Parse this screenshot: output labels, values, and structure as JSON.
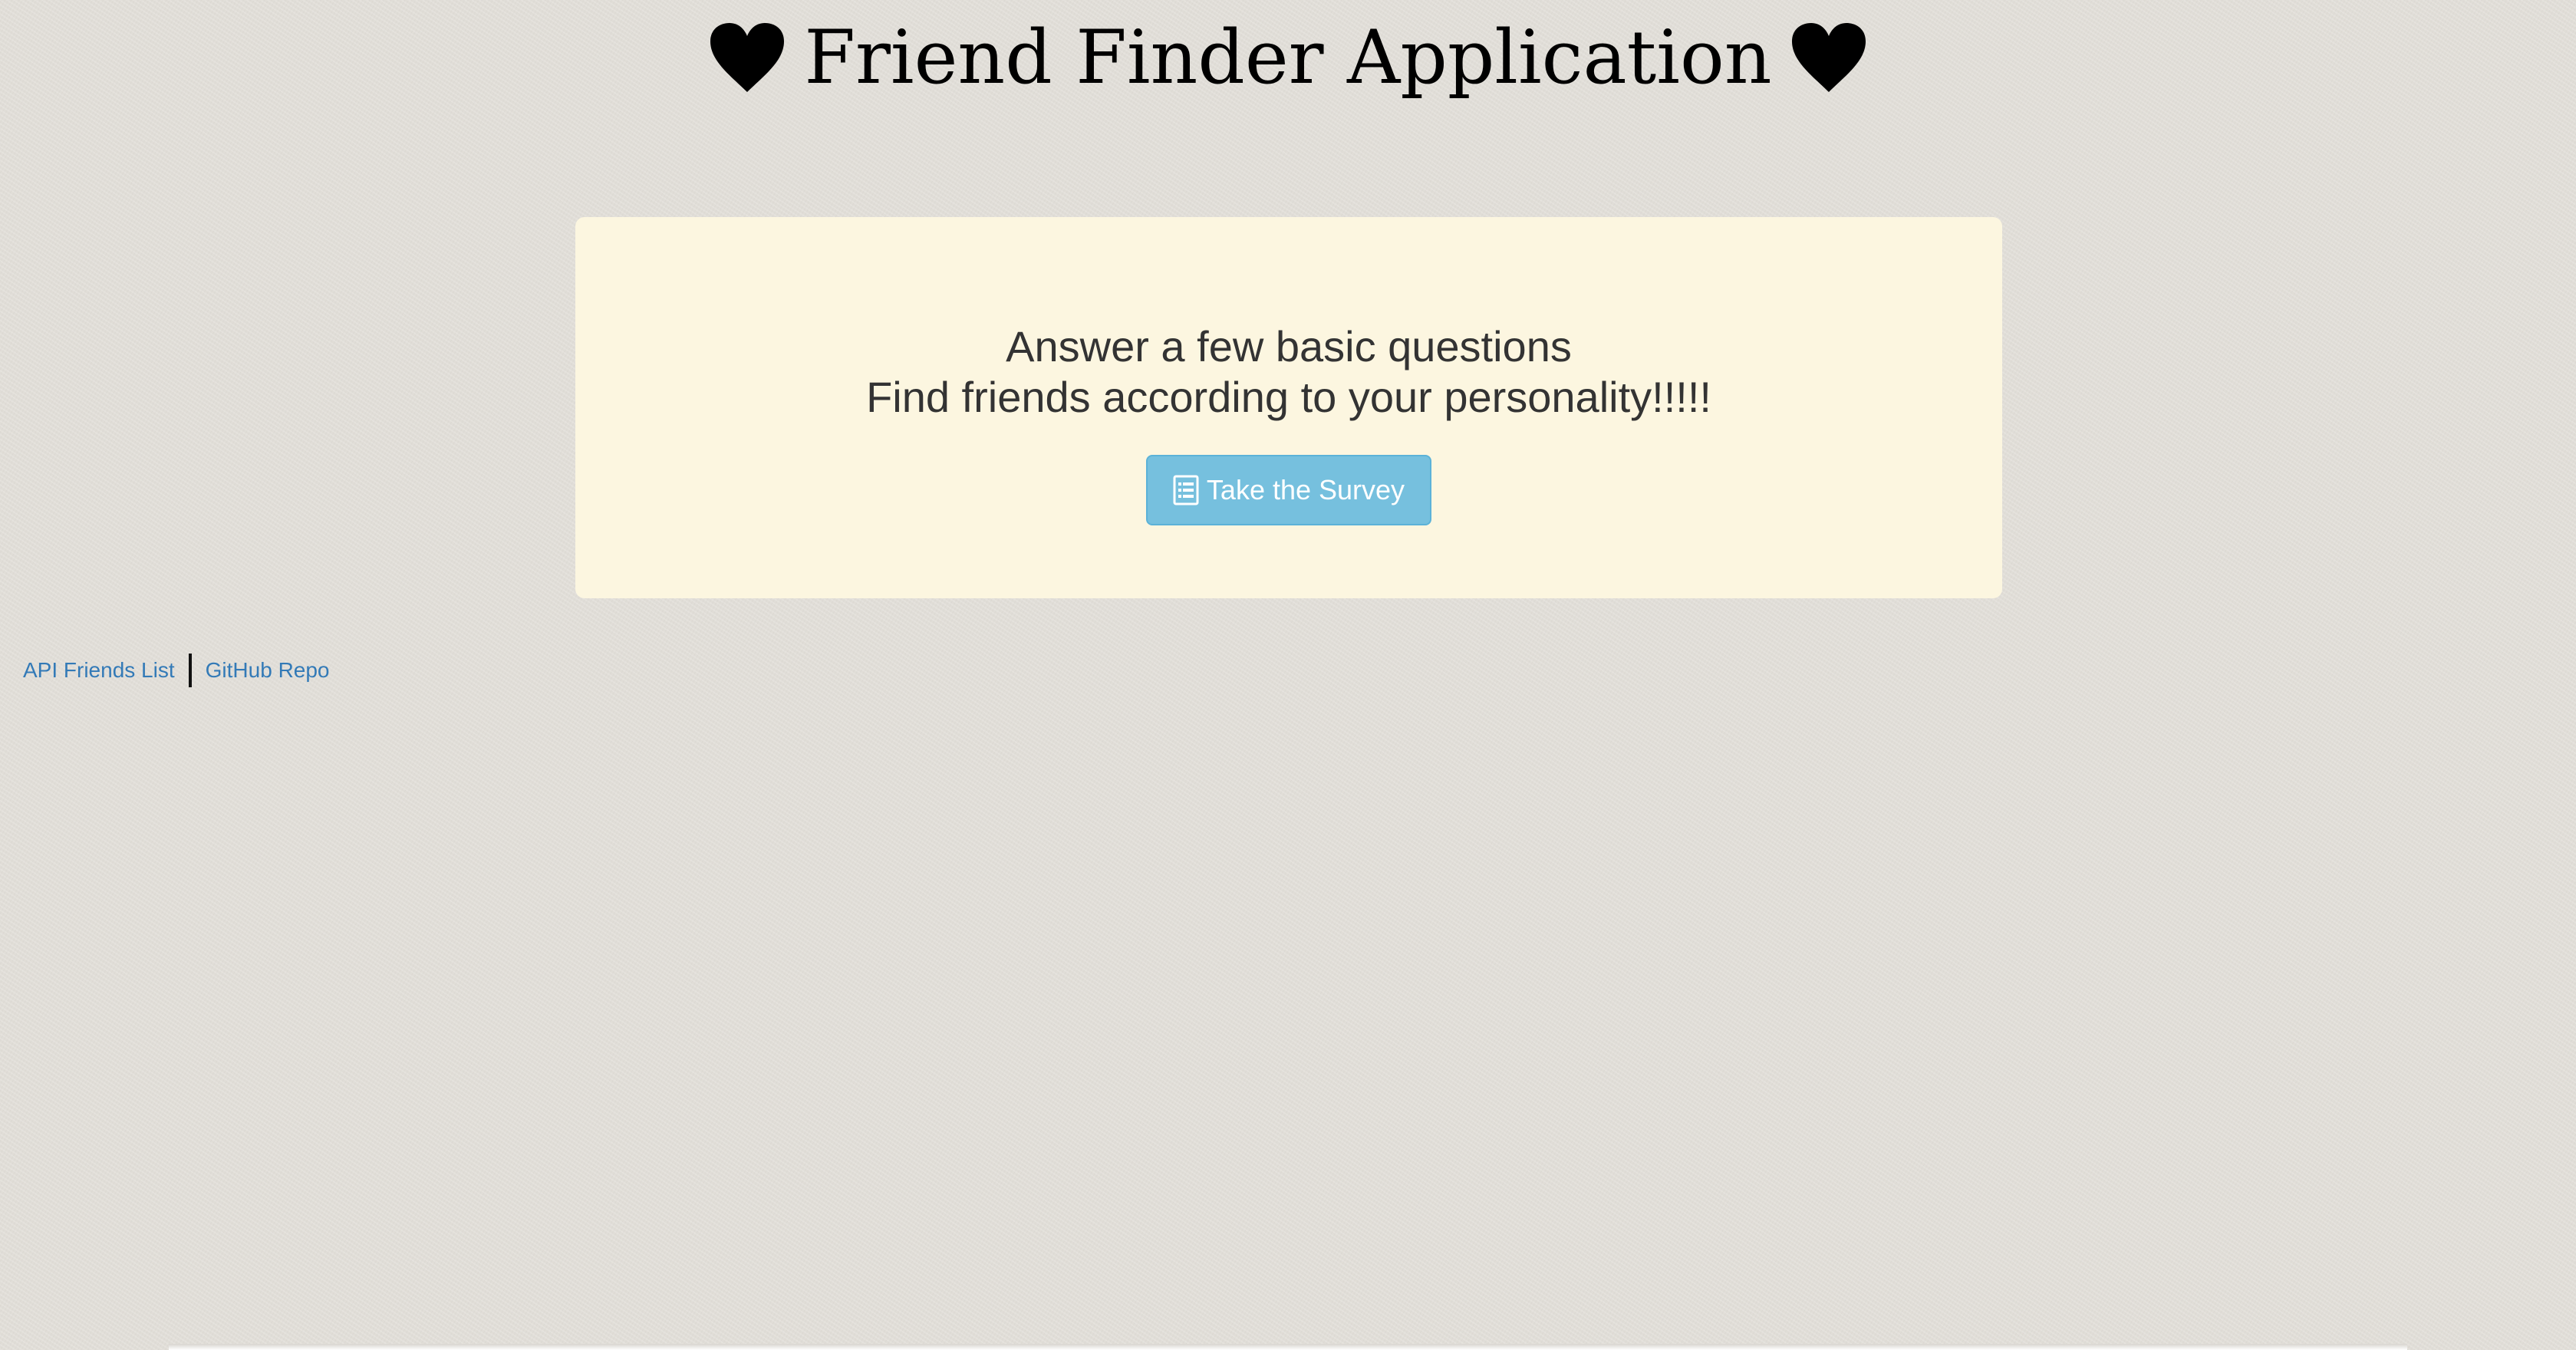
{
  "header": {
    "title": "Friend Finder Application",
    "left_icon": "heart-icon",
    "right_icon": "heart-icon"
  },
  "jumbotron": {
    "line1": "Answer a few basic questions",
    "line2": "Find friends according to your personality!!!!!",
    "survey_button": {
      "label": "Take the Survey",
      "icon": "list-alt-icon"
    }
  },
  "footer": {
    "links": [
      {
        "label": "API Friends List"
      },
      {
        "label": "GitHub Repo"
      }
    ]
  },
  "colors": {
    "page_background": "#e3e0da",
    "panel_background": "#fcf6e0",
    "button_background": "#76c0de",
    "link": "#337ab7",
    "heading_text": "#000000",
    "body_text": "#333333"
  }
}
